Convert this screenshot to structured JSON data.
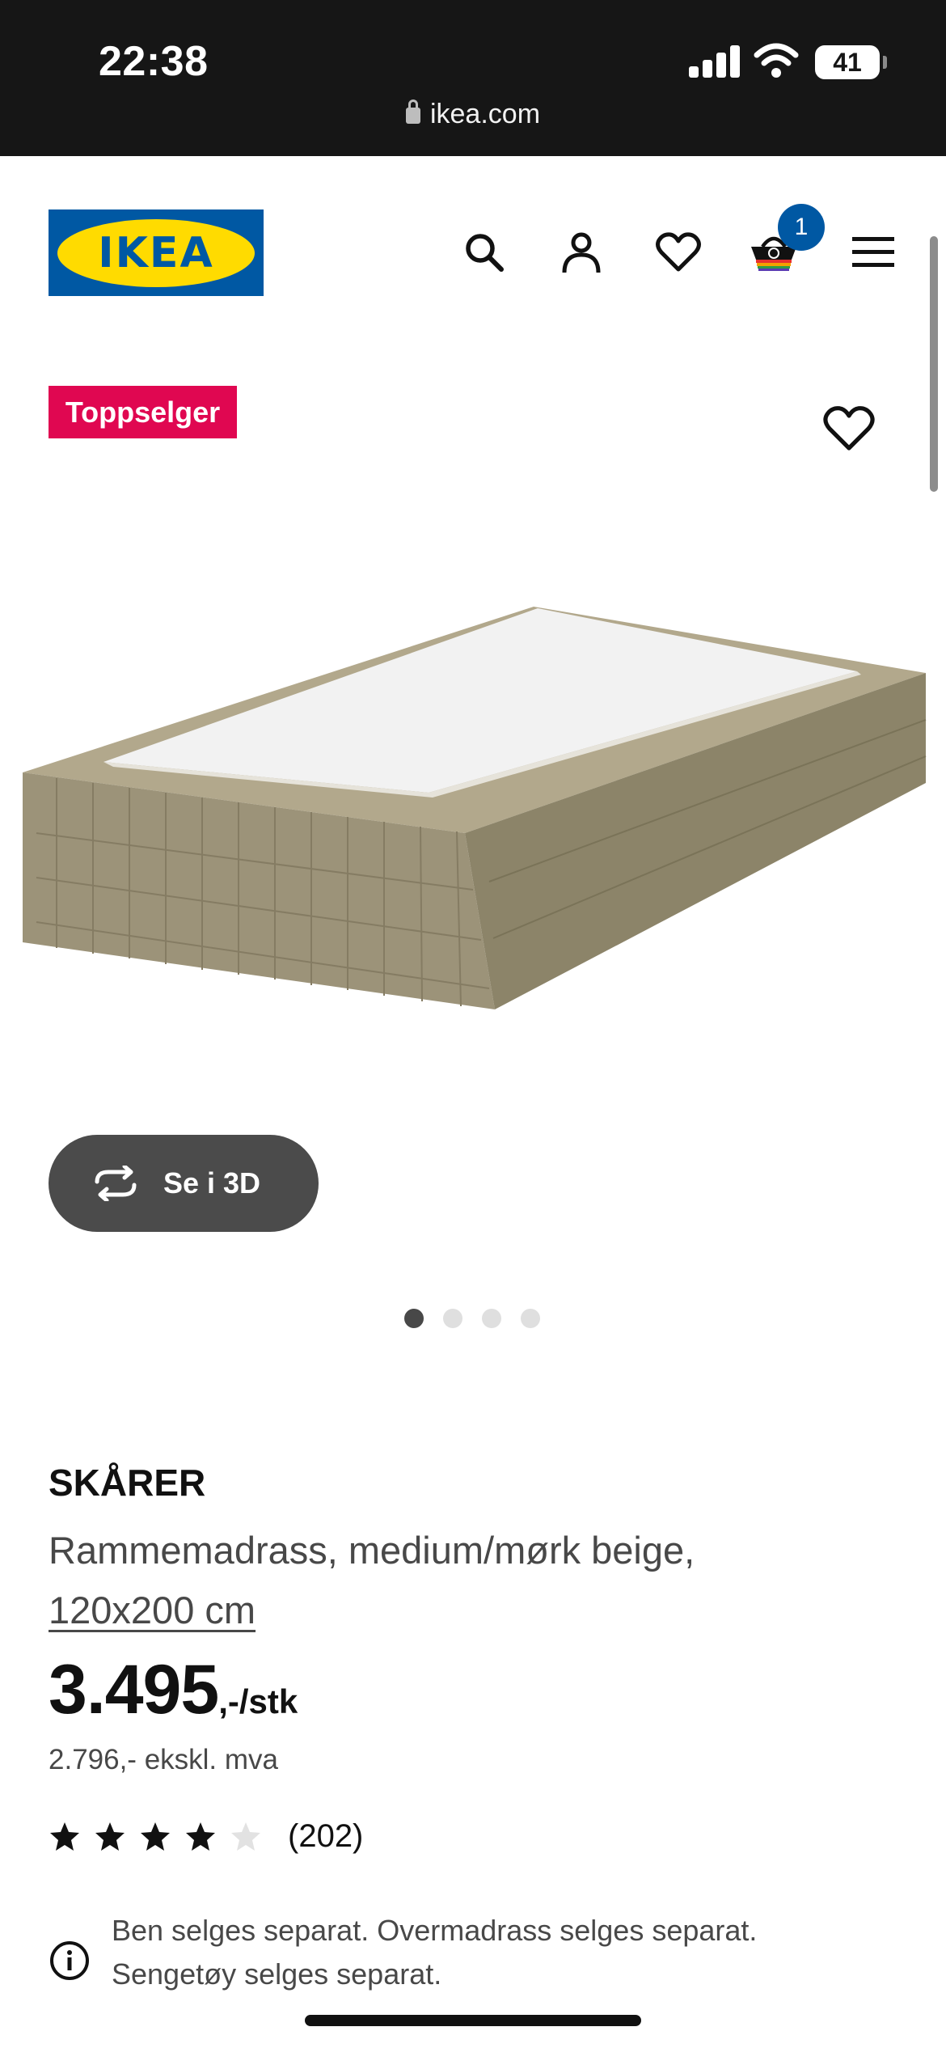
{
  "status_bar": {
    "time": "22:38",
    "battery": "41",
    "url": "ikea.com"
  },
  "header": {
    "logo_text": "IKEA",
    "cart_count": "1",
    "icons": [
      "search-icon",
      "user-icon",
      "heart-icon",
      "cart-icon",
      "menu-icon"
    ]
  },
  "product": {
    "badge": "Toppselger",
    "view_3d_label": "Se i 3D",
    "image_count": 4,
    "active_image": 1,
    "name": "SKÅRER",
    "description": "Rammemadrass, medium/mørk beige,",
    "size": "120x200 cm",
    "price_main": "3.495",
    "price_suffix": ",-/stk",
    "price_ex_vat": "2.796,- ekskl. mva",
    "rating_stars": 4,
    "rating_max": 5,
    "rating_count": "(202)",
    "notice_line1": "Ben selges separat. Overmadrass selges separat.",
    "notice_line2": "Sengetøy selges separat."
  },
  "colors": {
    "ikea_blue": "#0058a3",
    "ikea_yellow": "#ffdb00",
    "badge_red": "#e00751",
    "mattress_beige": "#9c9379"
  }
}
